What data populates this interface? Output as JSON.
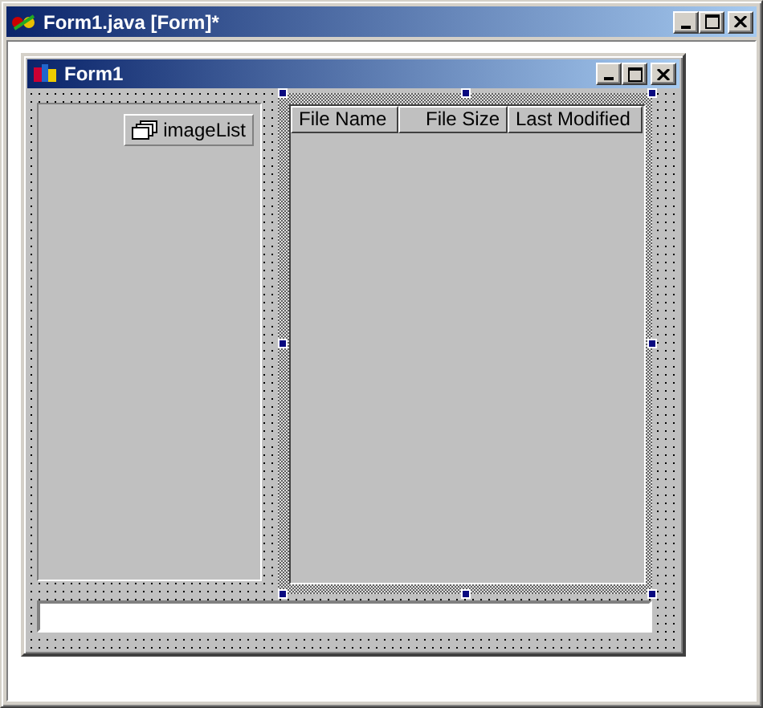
{
  "window": {
    "title": "Form1.java [Form]*"
  },
  "form": {
    "title": "Form1",
    "tray": {
      "label": "imageList"
    },
    "list_view": {
      "columns": [
        {
          "label": "File Name"
        },
        {
          "label": "File Size"
        },
        {
          "label": "Last Modified"
        }
      ]
    }
  }
}
